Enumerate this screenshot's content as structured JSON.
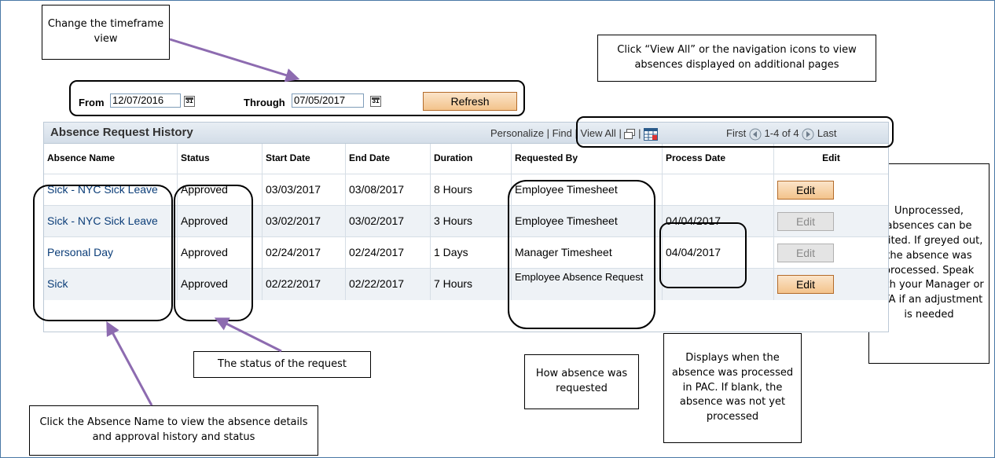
{
  "callouts": {
    "timeframe": "Change the timeframe view",
    "view_all": "Click “View All” or the navigation icons to view absences displayed on additional pages",
    "unprocessed": "Unprocessed, absences can be edited.  If greyed out, the absence was processed. Speak with your Manager or DTA if an adjustment is needed",
    "status": "The status of the request",
    "how_requested": "How absence was requested",
    "processed": "Displays when the absence was processed in PAC.  If blank, the absence was not yet processed",
    "absence_name": "Click the Absence Name to view the absence details and approval history and status"
  },
  "filter": {
    "from_label": "From",
    "from_value": "12/07/2016",
    "through_label": "Through",
    "through_value": "07/05/2017",
    "refresh_label": "Refresh"
  },
  "grid": {
    "title": "Absence Request History",
    "personalize": "Personalize",
    "find": "Find",
    "view_all": "View All",
    "first": "First",
    "range": "1-4 of 4",
    "last": "Last",
    "sep": "|",
    "columns": [
      "Absence Name",
      "Status",
      "Start Date",
      "End Date",
      "Duration",
      "Requested By",
      "Process Date",
      "Edit"
    ],
    "rows": [
      {
        "name": "Sick - NYC Sick Leave",
        "status": "Approved",
        "start": "03/03/2017",
        "end": "03/08/2017",
        "duration": "8 Hours",
        "requested_by": "Employee Timesheet",
        "process_date": "",
        "edit": "Edit",
        "edit_enabled": true
      },
      {
        "name": "Sick - NYC Sick Leave",
        "status": "Approved",
        "start": "03/02/2017",
        "end": "03/02/2017",
        "duration": "3 Hours",
        "requested_by": "Employee Timesheet",
        "process_date": "04/04/2017",
        "edit": "Edit",
        "edit_enabled": false
      },
      {
        "name": "Personal Day",
        "status": "Approved",
        "start": "02/24/2017",
        "end": "02/24/2017",
        "duration": "1 Days",
        "requested_by": "Manager Timesheet",
        "process_date": "04/04/2017",
        "edit": "Edit",
        "edit_enabled": false
      },
      {
        "name": "Sick",
        "status": "Approved",
        "start": "02/22/2017",
        "end": "02/22/2017",
        "duration": "7 Hours",
        "requested_by": "Employee Absence Request",
        "process_date": "",
        "edit": "Edit",
        "edit_enabled": true
      }
    ]
  },
  "icons": {
    "calendar": "calendar-icon",
    "new_window": "new-window-icon",
    "download": "download-grid-icon",
    "prev": "arrow-left-circle-icon",
    "next": "arrow-right-circle-icon"
  },
  "colors": {
    "arrow": "#8d6bb0",
    "link": "#0b3d78",
    "button": "#f3c38b",
    "grid_header": "#d3dde8"
  }
}
